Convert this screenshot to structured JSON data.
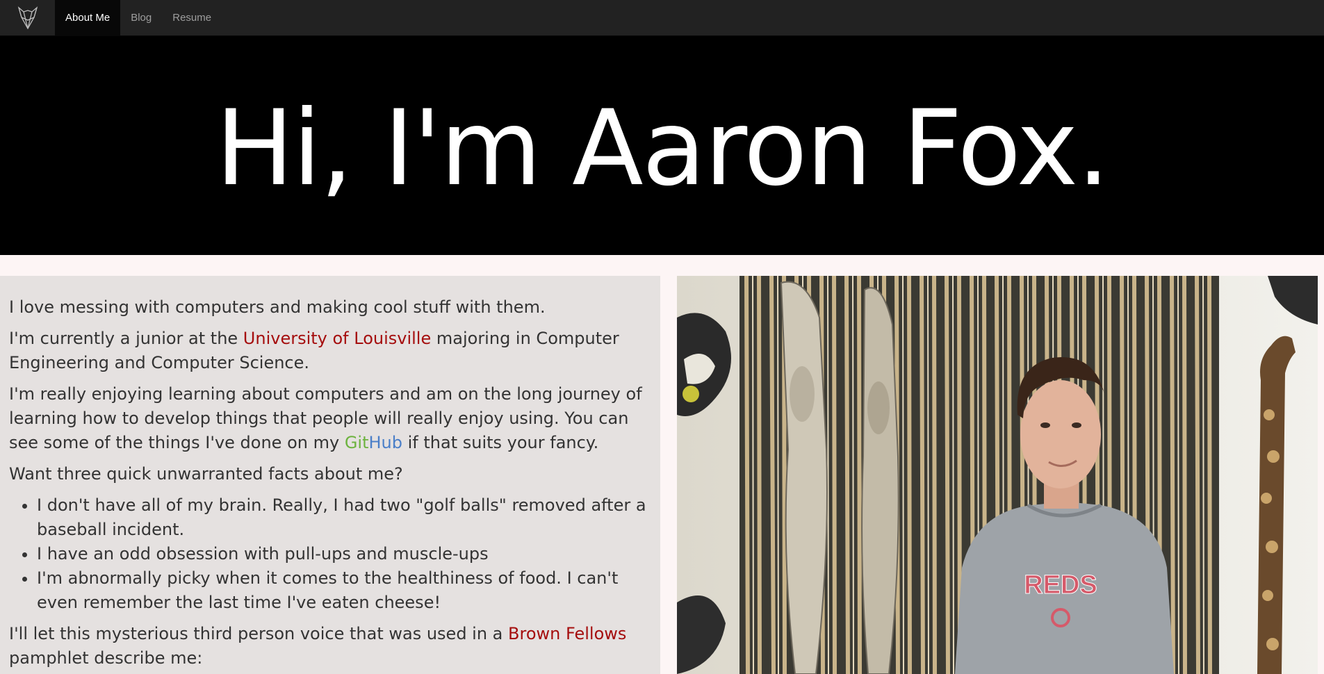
{
  "nav": {
    "items": [
      {
        "label": "About Me",
        "active": true
      },
      {
        "label": "Blog",
        "active": false
      },
      {
        "label": "Resume",
        "active": false
      }
    ]
  },
  "hero": {
    "title": "Hi, I'm Aaron Fox."
  },
  "about": {
    "p1": "I love messing with computers and making cool stuff with them.",
    "p2_before": "I'm currently a junior at the ",
    "p2_link": "University of Louisville",
    "p2_after": " majoring in Computer Engineering and Computer Science.",
    "p3_before": "I'm really enjoying learning about computers and am on the long journey of learning how to develop things that people will really enjoy using. You can see some of the things I've done on my ",
    "p3_link_git": "Git",
    "p3_link_hub": "Hub",
    "p3_after": " if that suits your fancy.",
    "p4": "Want three quick unwarranted facts about me?",
    "facts": [
      "I don't have all of my brain. Really, I had two \"golf balls\" removed after a baseball incident.",
      "I have an odd obsession with pull-ups and muscle-ups",
      "I'm abnormally picky when it comes to the healthiness of food. I can't even remember the last time I've eaten cheese!"
    ],
    "p5_before": "I'll let this mysterious third person voice that was used in a ",
    "p5_link": "Brown Fellows",
    "p5_after": " pamphlet describe me:"
  },
  "photo": {
    "shirt_text": "REDS"
  },
  "colors": {
    "navbar": "#222222",
    "hero_bg": "#000000",
    "panel_bg": "#e5e1e0",
    "link_red": "#a50e0e",
    "git_green": "#6db33f",
    "hub_blue": "#4b7fc8"
  }
}
